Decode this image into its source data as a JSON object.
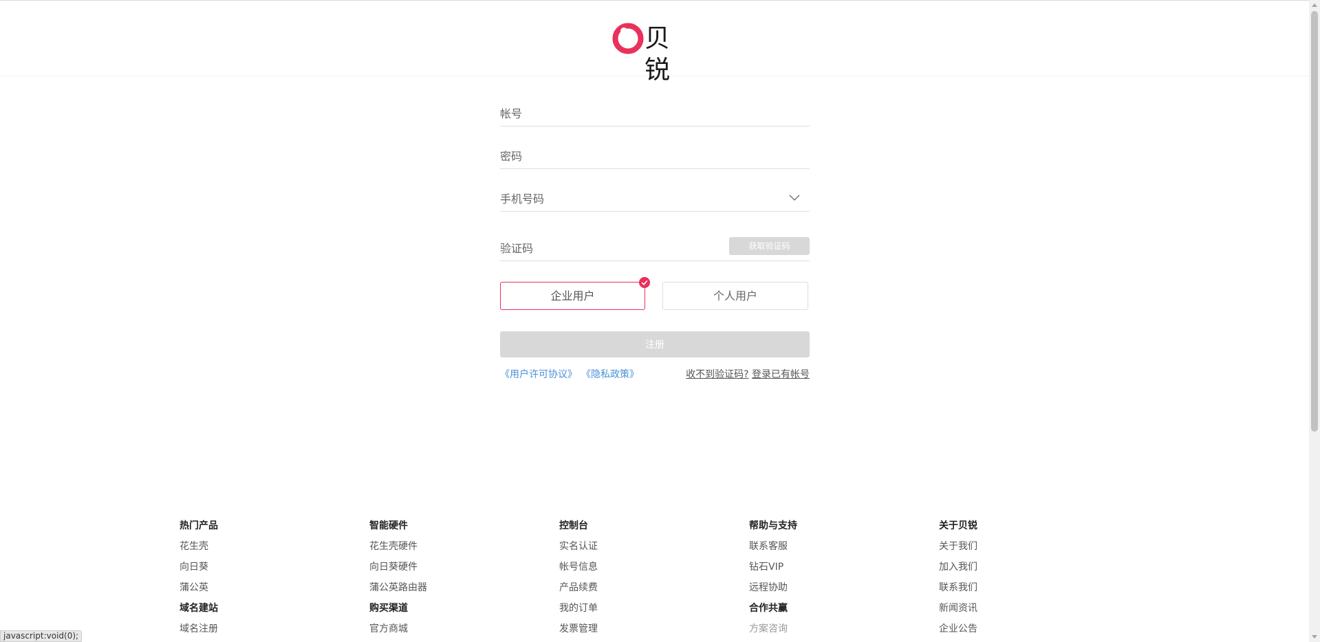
{
  "header": {
    "brand_name": "贝锐",
    "brand_color": "#e8325b"
  },
  "form": {
    "account_placeholder": "帐号",
    "password_placeholder": "密码",
    "phone_placeholder": "手机号码",
    "code_placeholder": "验证码",
    "get_code_label": "获取验证码",
    "user_types": {
      "enterprise": "企业用户",
      "personal": "个人用户",
      "selected": "企业用户"
    },
    "register_label": "注册",
    "agreement_link": "《用户许可协议》",
    "privacy_link": "《隐私政策》",
    "no_code_link": "收不到验证码?",
    "login_link": "登录已有帐号"
  },
  "footer": {
    "columns": [
      {
        "heading": "热门产品",
        "items": [
          "花生壳",
          "向日葵",
          "蒲公英"
        ],
        "heading2": "域名建站",
        "items2": [
          "域名注册"
        ]
      },
      {
        "heading": "智能硬件",
        "items": [
          "花生壳硬件",
          "向日葵硬件",
          "蒲公英路由器"
        ],
        "heading2": "购买渠道",
        "items2": [
          "官方商城"
        ]
      },
      {
        "heading": "控制台",
        "items": [
          "实名认证",
          "帐号信息",
          "产品续费",
          "我的订单",
          "发票管理"
        ]
      },
      {
        "heading": "帮助与支持",
        "items": [
          "联系客服",
          "钻石VIP",
          "远程协助"
        ],
        "heading2": "合作共赢",
        "items2": [
          "方案咨询"
        ]
      },
      {
        "heading": "关于贝锐",
        "items": [
          "关于我们",
          "加入我们",
          "联系我们",
          "新闻资讯",
          "企业公告"
        ]
      }
    ]
  },
  "status_bar": {
    "text": "javascript:void(0);"
  }
}
